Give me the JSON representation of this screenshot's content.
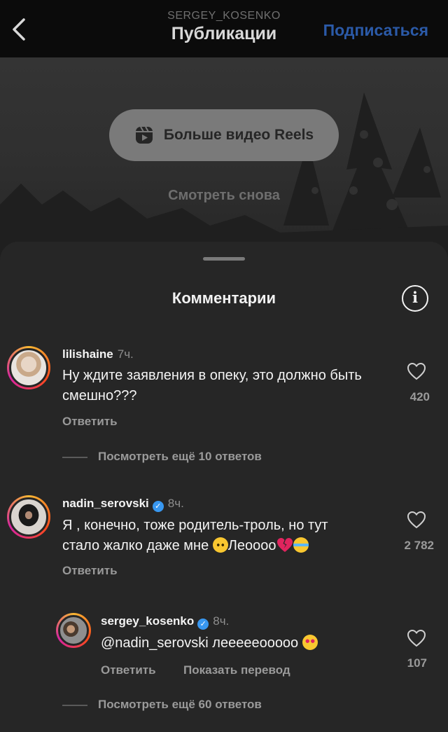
{
  "header": {
    "username": "SERGEY_KOSENKO",
    "title": "Публикации",
    "subscribe_label": "Подписаться"
  },
  "video": {
    "reels_button_label": "Больше видео Reels",
    "rewatch_label": "Смотреть снова"
  },
  "comments_sheet": {
    "title": "Комментарии",
    "info_icon": "info-icon"
  },
  "comments": [
    {
      "username": "lilishaine",
      "time": "7ч.",
      "text": "Ну ждите заявления в опеку, это должно быть смешно???",
      "reply_label": "Ответить",
      "likes": "420",
      "view_more": "Посмотреть ещё 10 ответов",
      "verified": false
    },
    {
      "username": "nadin_serovski",
      "time": "8ч.",
      "text_line1": "Я , конечно, тоже родитель-троль, но тут",
      "text_line2": "стало жалко даже мне",
      "text_line2_tail": "Леоооо",
      "emojis": [
        "pleading-face",
        "broken-heart",
        "loudly-crying-face"
      ],
      "reply_label": "Ответить",
      "likes": "2 782",
      "verified": true
    }
  ],
  "reply": {
    "username": "sergey_kosenko",
    "time": "8ч.",
    "mention": "@nadin_serovski",
    "text": "леееееооооо",
    "emoji": "heart-eyes-face",
    "reply_label": "Ответить",
    "translate_label": "Показать перевод",
    "likes": "107",
    "verified": true
  },
  "view_more_bottom": "Посмотреть ещё 60 ответов",
  "colors": {
    "sheet_bg": "#262626",
    "subscribe_blue": "#2b5aa8",
    "verified_blue": "#3897f0",
    "broken_heart": "#e0245e"
  }
}
